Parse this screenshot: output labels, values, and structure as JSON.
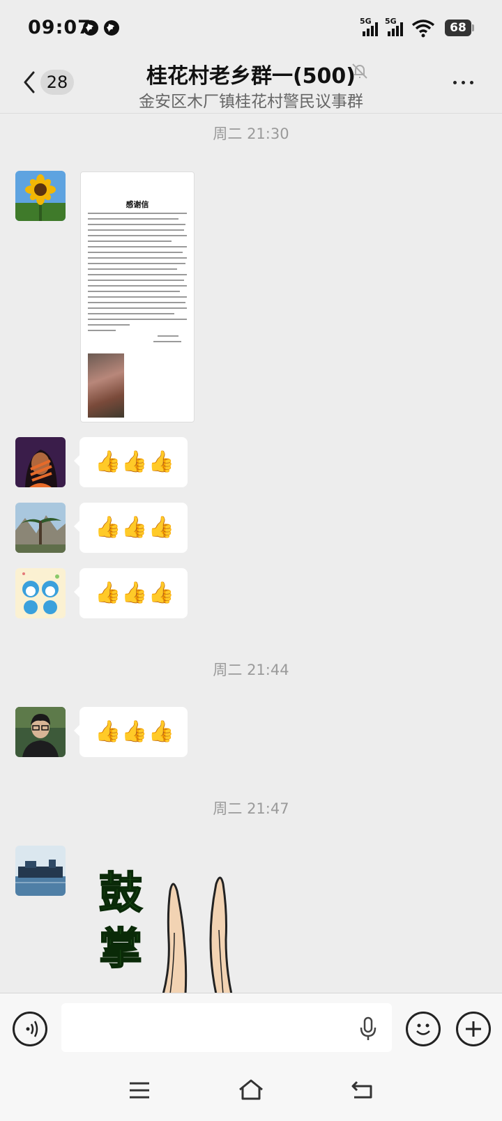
{
  "status_bar": {
    "time": "09:07",
    "signal_1_label": "5G",
    "signal_2_label": "5G",
    "battery_level": "68"
  },
  "header": {
    "back_badge": "28",
    "title": "桂花村老乡群一(500)",
    "subtitle": "金安区木厂镇桂花村警民议事群",
    "back_icon": "chevron-left-icon",
    "mute_icon": "bell-off-icon",
    "more_icon": "more-dots-icon"
  },
  "chat": {
    "timestamps": [
      "周二 21:30",
      "周二 21:44",
      "周二 21:47"
    ],
    "letter_title": "感谢信",
    "thumbs_text": "👍👍👍",
    "sticker_chars": [
      "鼓",
      "掌"
    ]
  },
  "input": {
    "voice_icon": "voice-icon",
    "mic_icon": "microphone-icon",
    "emoji_icon": "emoji-icon",
    "plus_icon": "plus-icon"
  },
  "nav": {
    "menu_icon": "menu-icon",
    "home_icon": "home-icon",
    "back_icon": "back-icon"
  },
  "colors": {
    "background": "#ededed",
    "bubble": "#ffffff",
    "sticker_text": "#1e5c18"
  }
}
